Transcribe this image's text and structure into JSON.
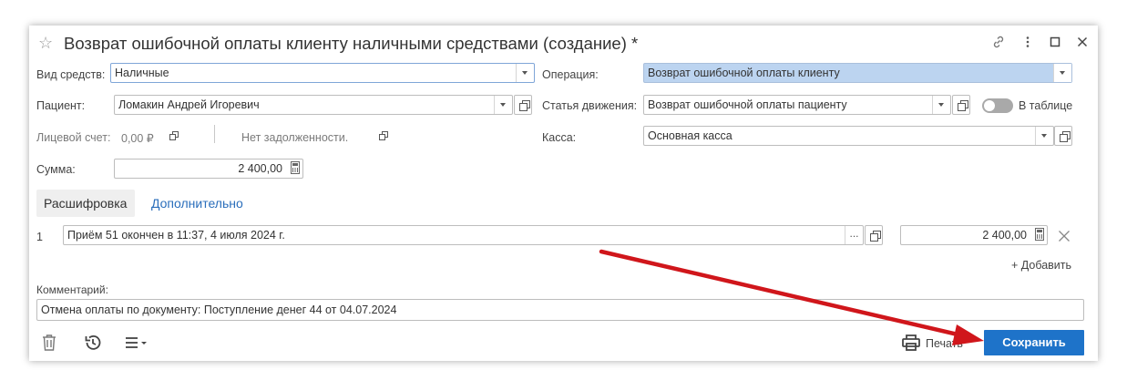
{
  "window": {
    "title": "Возврат ошибочной оплаты клиенту наличными средствами (создание) *"
  },
  "form": {
    "vid_sredstv": {
      "label": "Вид средств:",
      "value": "Наличные"
    },
    "patient": {
      "label": "Пациент:",
      "value": "Ломакин Андрей Игоревич"
    },
    "account": {
      "label": "Лицевой счет:",
      "amount": "0,00 ₽",
      "debt": "Нет задолженности."
    },
    "summa": {
      "label": "Сумма:",
      "value": "2 400,00"
    },
    "operation": {
      "label": "Операция:",
      "value": "Возврат ошибочной оплаты клиенту"
    },
    "statya": {
      "label": "Статья движения:",
      "value": "Возврат ошибочной оплаты пациенту"
    },
    "in_table": {
      "label": "В таблице",
      "enabled": false
    },
    "kassa": {
      "label": "Касса:",
      "value": "Основная касса"
    }
  },
  "tabs": [
    {
      "label": "Расшифровка",
      "active": true
    },
    {
      "label": "Дополнительно",
      "active": false
    }
  ],
  "rows": [
    {
      "num": "1",
      "text": "Приём 51 окончен в 11:37, 4 июля 2024 г.",
      "amount": "2 400,00"
    }
  ],
  "actions": {
    "add": "+ Добавить",
    "print": "Печать",
    "save": "Сохранить",
    "more_dots": "..."
  },
  "comment": {
    "label": "Комментарий:",
    "value": "Отмена оплаты по документу: Поступление денег 44 от 04.07.2024"
  },
  "colors": {
    "accent": "#1e73c9",
    "selected_field": "#bcd4f0",
    "arrow": "#d0161b",
    "link": "#2a6ebb"
  }
}
